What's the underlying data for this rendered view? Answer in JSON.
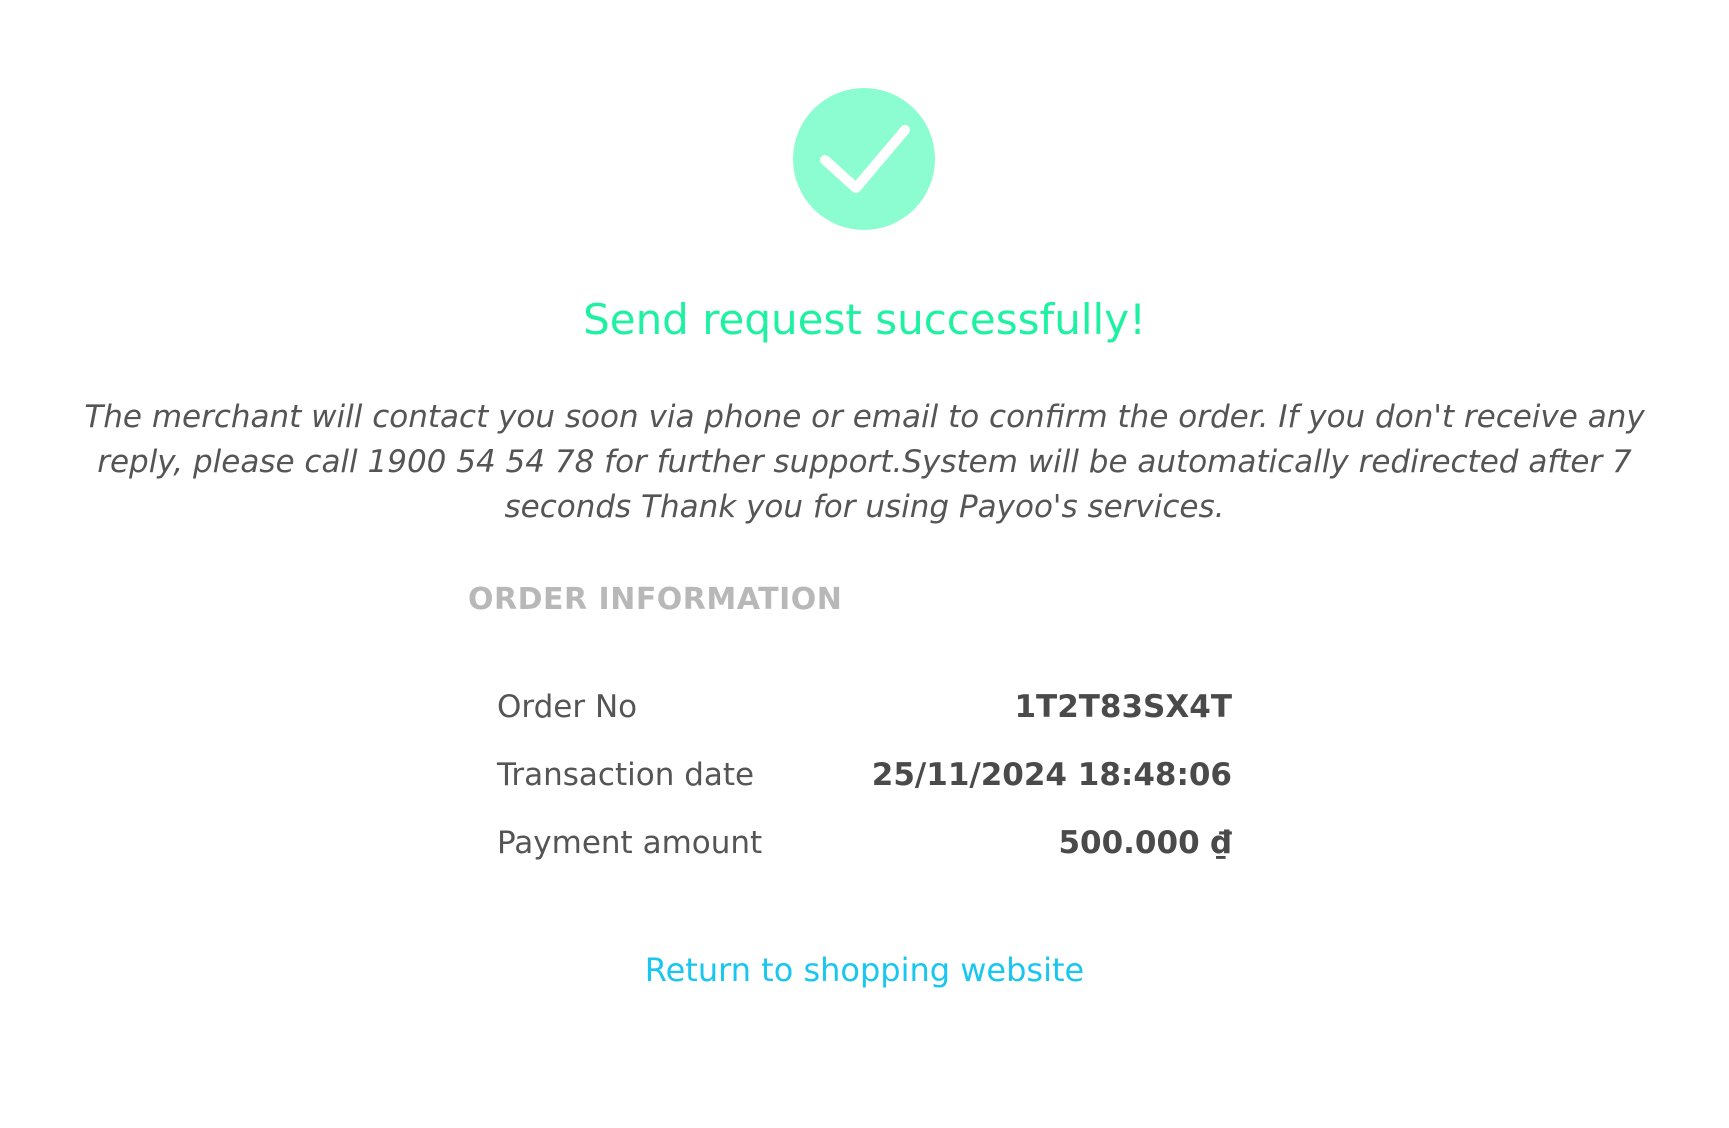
{
  "status": {
    "icon": "checkmark-icon",
    "circle_color": "#8cfdd0",
    "title": "Send request successfully!",
    "title_color": "#1ef2a2",
    "message": "The merchant will contact you soon via phone or email to confirm the order. If you don't receive any reply, please call 1900 54 54 78 for further support.System will be automatically redirected after 7 seconds Thank you for using Payoo's services."
  },
  "order": {
    "heading": "ORDER INFORMATION",
    "rows": [
      {
        "label": "Order No",
        "value": "1T2T83SX4T"
      },
      {
        "label": "Transaction date",
        "value": "25/11/2024 18:48:06"
      },
      {
        "label": "Payment amount",
        "value": "500.000 ₫"
      }
    ]
  },
  "actions": {
    "return_label": "Return to shopping website",
    "link_color": "#19c6f0"
  }
}
